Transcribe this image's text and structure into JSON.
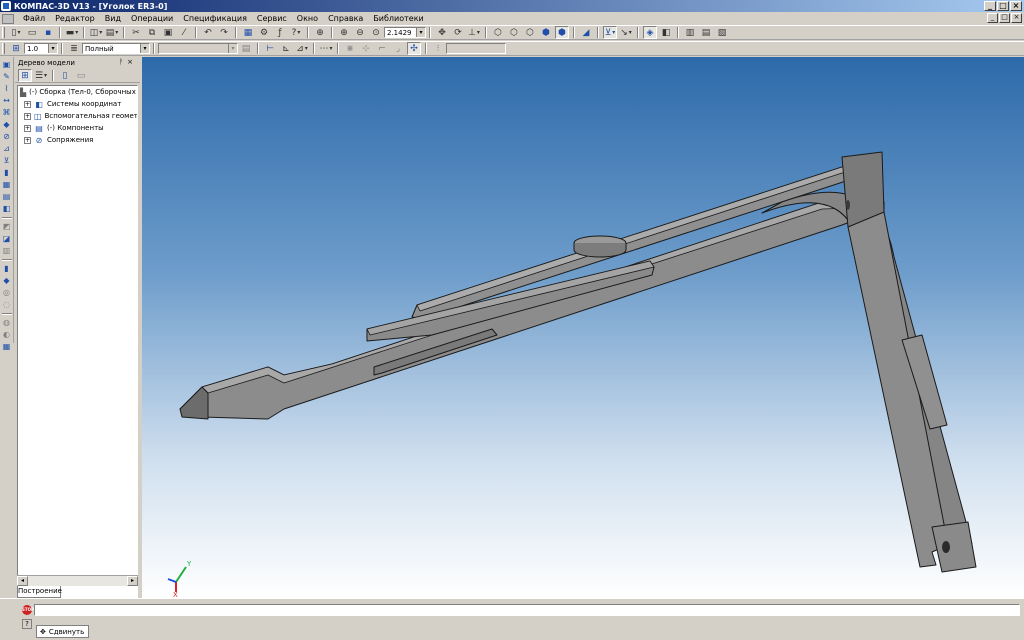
{
  "window": {
    "title": "КОМПАС-3D V13 - [Уголок ER3-0]",
    "min_glyph": "_",
    "max_glyph": "□",
    "close_glyph": "×"
  },
  "menu": {
    "items": [
      "Файл",
      "Редактор",
      "Вид",
      "Операции",
      "Спецификация",
      "Сервис",
      "Окно",
      "Справка",
      "Библиотеки"
    ]
  },
  "toolbar1": {
    "zoom_value": "2.1429"
  },
  "toolbar2": {
    "scale_value": "1.0",
    "line_style_value": "Полный",
    "layer_value": ""
  },
  "tree_panel": {
    "title": "Дерево модели",
    "pin_glyph": "ᚹ",
    "close_glyph": "×",
    "items": [
      {
        "label": "(-) Сборка (Тел-0, Сборочных е",
        "icon": "assembly-icon",
        "expander": ""
      },
      {
        "label": "Системы координат",
        "icon": "coordinate-system-icon",
        "expander": "+"
      },
      {
        "label": "Вспомогательная геометрия",
        "icon": "auxiliary-geometry-icon",
        "expander": "+"
      },
      {
        "label": "(-) Компоненты",
        "icon": "components-icon",
        "expander": "+"
      },
      {
        "label": "Сопряжения",
        "icon": "mates-icon",
        "expander": "+"
      }
    ],
    "tab_label": "Построение"
  },
  "viewport": {
    "axis_x_label": "X",
    "axis_y_label": "Y",
    "colors": {
      "part_face": "#8c8c8c",
      "part_top": "#a8a8a8",
      "part_edge": "#1a1a1a",
      "axis_x": "#e02020",
      "axis_y": "#20b040",
      "axis_z": "#2050e0"
    }
  },
  "statusbar": {
    "prompt_text": "",
    "action_label": "Сдвинуть"
  }
}
